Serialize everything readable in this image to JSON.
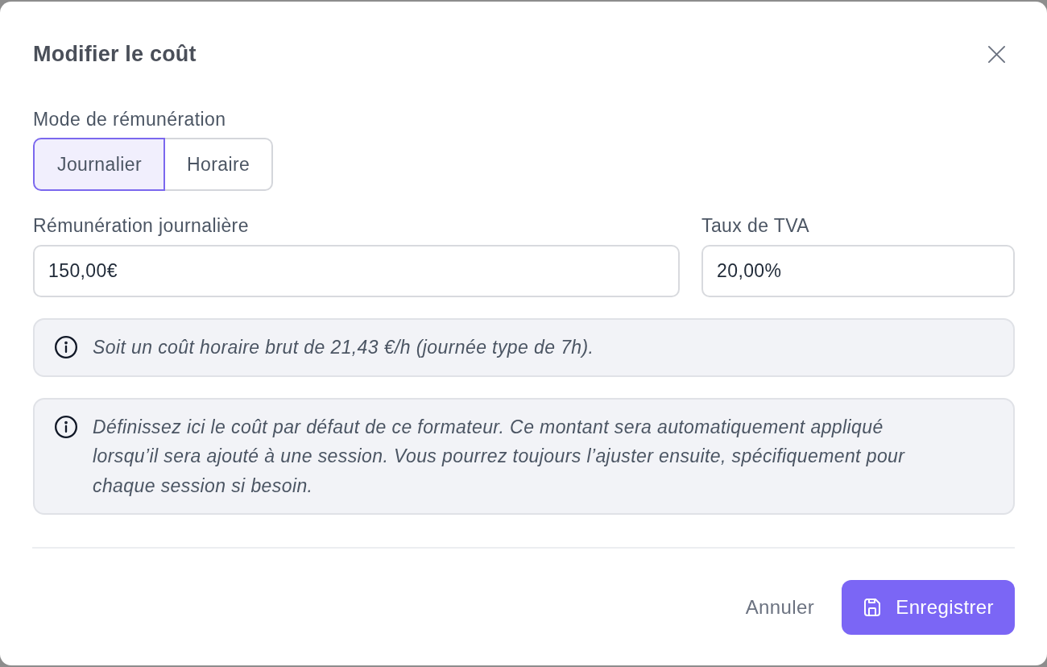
{
  "dialog": {
    "title": "Modifier le coût"
  },
  "mode": {
    "label": "Mode de rémunération",
    "options": [
      {
        "label": "Journalier",
        "selected": true
      },
      {
        "label": "Horaire",
        "selected": false
      }
    ]
  },
  "fields": [
    {
      "label": "Rémunération journalière",
      "value": "150,00€"
    },
    {
      "label": "Taux de TVA",
      "value": "20,00%"
    }
  ],
  "notes": [
    "Soit un coût horaire brut de 21,43 €/h (journée type de 7h).",
    "Définissez ici le coût par défaut de ce formateur. Ce montant sera automatiquement appliqué lorsqu’il sera ajouté à une session. Vous pourrez toujours l’ajuster ensuite, spécifiquement pour chaque session si besoin."
  ],
  "buttons": [
    {
      "label": "Annuler",
      "kind": "secondary"
    },
    {
      "label": "Enregistrer",
      "kind": "primary"
    }
  ]
}
